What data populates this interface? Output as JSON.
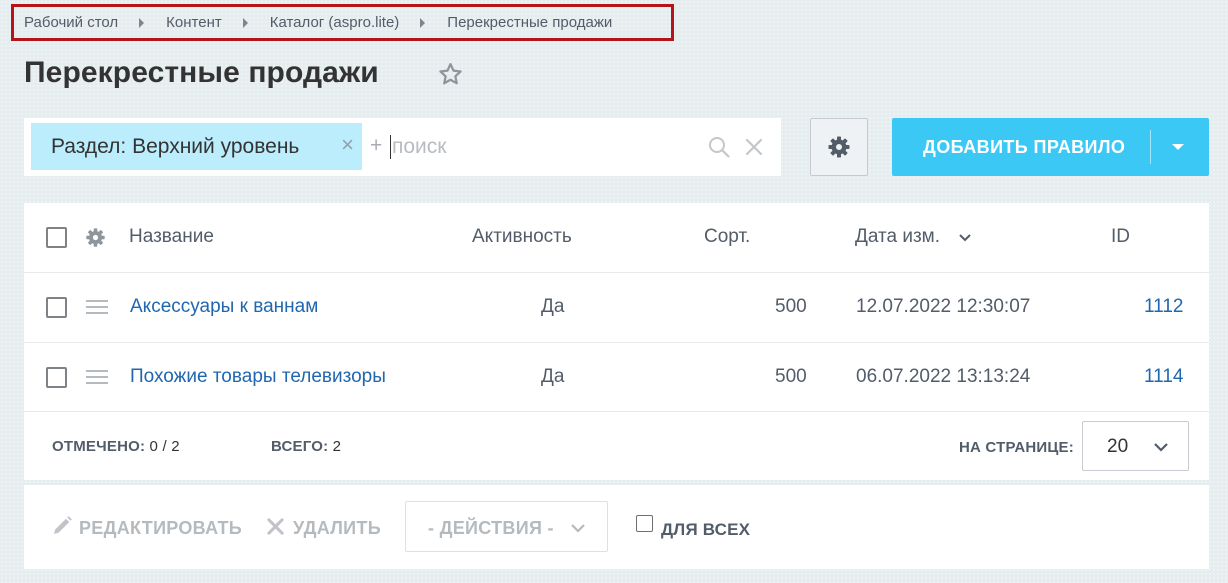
{
  "breadcrumb": {
    "items": [
      {
        "label": "Рабочий стол"
      },
      {
        "label": "Контент"
      },
      {
        "label": "Каталог (aspro.lite)"
      },
      {
        "label": "Перекрестные продажи"
      }
    ],
    "highlight_color": "#b3151b"
  },
  "page": {
    "title": "Перекрестные продажи",
    "favorite_icon": "star-icon"
  },
  "filter": {
    "tag_label": "Раздел: Верхний уровень",
    "tag_close": "×",
    "add_symbol": "+",
    "search_placeholder": "поиск",
    "search_value": ""
  },
  "toolbar": {
    "settings_icon": "gear-icon",
    "add_label": "ДОБАВИТЬ ПРАВИЛО",
    "accent_color": "#3bc8f5"
  },
  "grid": {
    "columns": {
      "name": "Название",
      "active": "Активность",
      "sort": "Сорт.",
      "date": "Дата изм.",
      "id": "ID"
    },
    "rows": [
      {
        "name": "Аксессуары к ваннам",
        "active": "Да",
        "sort": "500",
        "date": "12.07.2022 12:30:07",
        "id": "1112"
      },
      {
        "name": "Похожие товары телевизоры",
        "active": "Да",
        "sort": "500",
        "date": "06.07.2022 13:13:24",
        "id": "1114"
      }
    ],
    "footer": {
      "selected_label": "ОТМЕЧЕНО:",
      "selected_value": "0 / 2",
      "total_label": "ВСЕГО:",
      "total_value": "2",
      "per_page_label": "НА СТРАНИЦЕ:",
      "per_page_value": "20"
    },
    "link_color": "#2067b0"
  },
  "actions": {
    "edit_label": "РЕДАКТИРОВАТЬ",
    "delete_label": "УДАЛИТЬ",
    "actions_select": "- ДЕЙСТВИЯ -",
    "for_all_label": "ДЛЯ ВСЕХ"
  }
}
